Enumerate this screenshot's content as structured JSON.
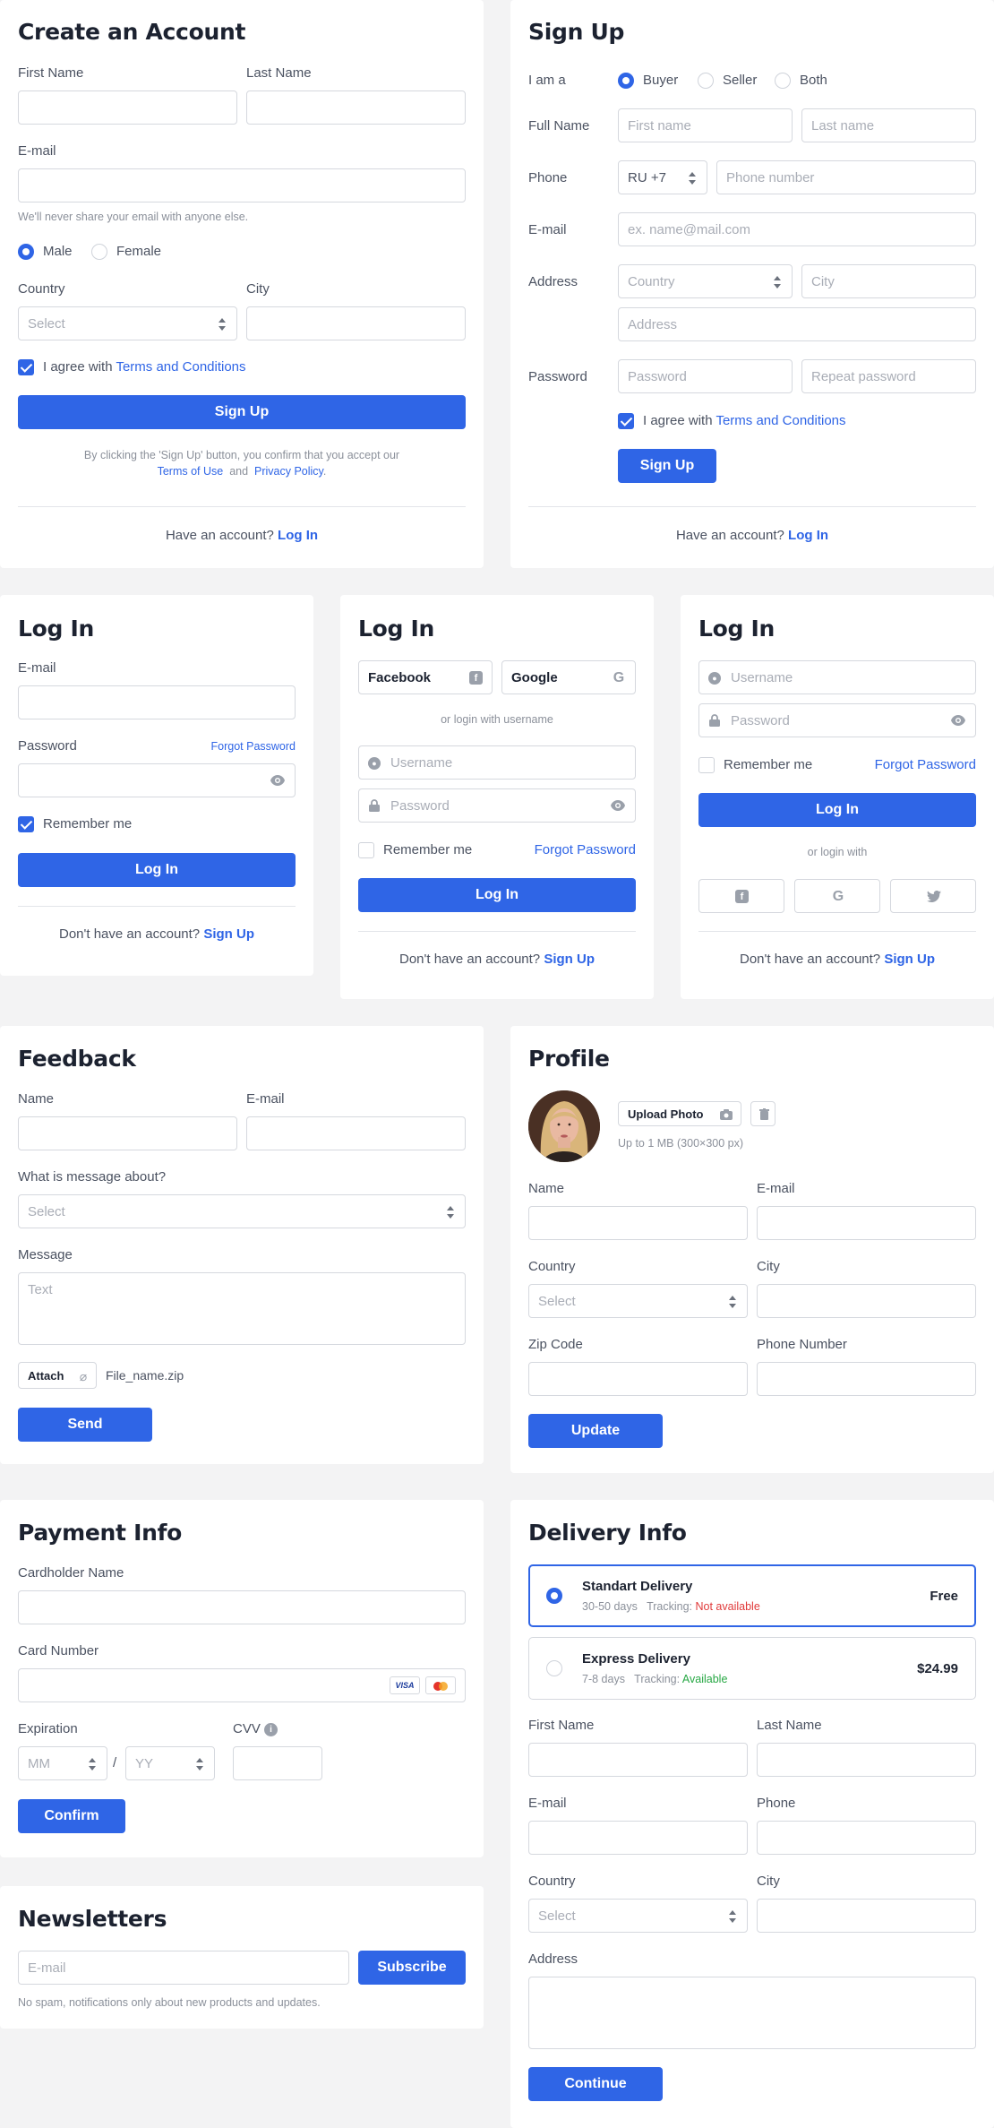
{
  "create_account": {
    "title": "Create an Account",
    "first_name_label": "First Name",
    "last_name_label": "Last Name",
    "email_label": "E-mail",
    "email_help": "We'll never share your email with anyone else.",
    "gender_male": "Male",
    "gender_female": "Female",
    "country_label": "Country",
    "city_label": "City",
    "country_placeholder": "Select",
    "agree_text": "I agree with",
    "terms_link": "Terms and Conditions",
    "submit": "Sign Up",
    "legal_line1": "By clicking the 'Sign Up' button, you confirm that you accept our",
    "terms_of_use": "Terms of Use",
    "and": "and",
    "privacy": "Privacy Policy",
    "have_account": "Have an account?",
    "login_link": "Log In"
  },
  "sign_up": {
    "title": "Sign Up",
    "i_am_a": "I am a",
    "opt_buyer": "Buyer",
    "opt_seller": "Seller",
    "opt_both": "Both",
    "full_name": "Full Name",
    "first_ph": "First name",
    "last_ph": "Last name",
    "phone": "Phone",
    "phone_code": "RU +7",
    "phone_ph": "Phone number",
    "email": "E-mail",
    "email_ph": "ex. name@mail.com",
    "address": "Address",
    "country_ph": "Country",
    "city_ph": "City",
    "address_ph": "Address",
    "password": "Password",
    "password_ph": "Password",
    "repeat_ph": "Repeat password",
    "agree_text": "I agree with",
    "terms_link": "Terms and Conditions",
    "submit": "Sign Up",
    "have_account": "Have an account?",
    "login_link": "Log In"
  },
  "login1": {
    "title": "Log In",
    "email": "E-mail",
    "password": "Password",
    "forgot": "Forgot Password",
    "remember": "Remember me",
    "submit": "Log In",
    "no_account": "Don't have an account?",
    "signup_link": "Sign Up"
  },
  "login2": {
    "title": "Log In",
    "facebook": "Facebook",
    "google": "Google",
    "or_username": "or login with username",
    "username_ph": "Username",
    "password_ph": "Password",
    "remember": "Remember me",
    "forgot": "Forgot Password",
    "submit": "Log In",
    "no_account": "Don't have an account?",
    "signup_link": "Sign Up"
  },
  "login3": {
    "title": "Log In",
    "username_ph": "Username",
    "password_ph": "Password",
    "remember": "Remember me",
    "forgot": "Forgot Password",
    "submit": "Log In",
    "or_with": "or login with",
    "no_account": "Don't have an account?",
    "signup_link": "Sign Up"
  },
  "feedback": {
    "title": "Feedback",
    "name": "Name",
    "email": "E-mail",
    "about": "What is message about?",
    "about_ph": "Select",
    "message": "Message",
    "message_ph": "Text",
    "attach": "Attach",
    "file_name": "File_name.zip",
    "submit": "Send"
  },
  "profile": {
    "title": "Profile",
    "upload": "Upload Photo",
    "upload_hint": "Up to 1 MB (300×300 px)",
    "name": "Name",
    "email": "E-mail",
    "country": "Country",
    "country_ph": "Select",
    "city": "City",
    "zip": "Zip Code",
    "phone": "Phone Number",
    "submit": "Update"
  },
  "payment": {
    "title": "Payment Info",
    "cardholder": "Cardholder Name",
    "card_number": "Card Number",
    "visa": "VISA",
    "expiration": "Expiration",
    "mm": "MM",
    "slash": "/",
    "yy": "YY",
    "cvv": "CVV",
    "submit": "Confirm"
  },
  "newsletters": {
    "title": "Newsletters",
    "email_ph": "E-mail",
    "submit": "Subscribe",
    "note": "No spam, notifications only about new products and updates."
  },
  "delivery": {
    "title": "Delivery Info",
    "options": [
      {
        "name": "Standart Delivery",
        "days": "30-50 days",
        "tracking_label": "Tracking:",
        "tracking": "Not available",
        "price": "Free"
      },
      {
        "name": "Express Delivery",
        "days": "7-8 days",
        "tracking_label": "Tracking:",
        "tracking": "Available",
        "price": "$24.99"
      }
    ],
    "first_name": "First Name",
    "last_name": "Last Name",
    "email": "E-mail",
    "phone": "Phone",
    "country": "Country",
    "country_ph": "Select",
    "city": "City",
    "address": "Address",
    "submit": "Continue"
  },
  "colors": {
    "accent": "#2f65e6",
    "error": "#e03a3a",
    "success": "#27a844",
    "background": "#f3f3f4"
  }
}
